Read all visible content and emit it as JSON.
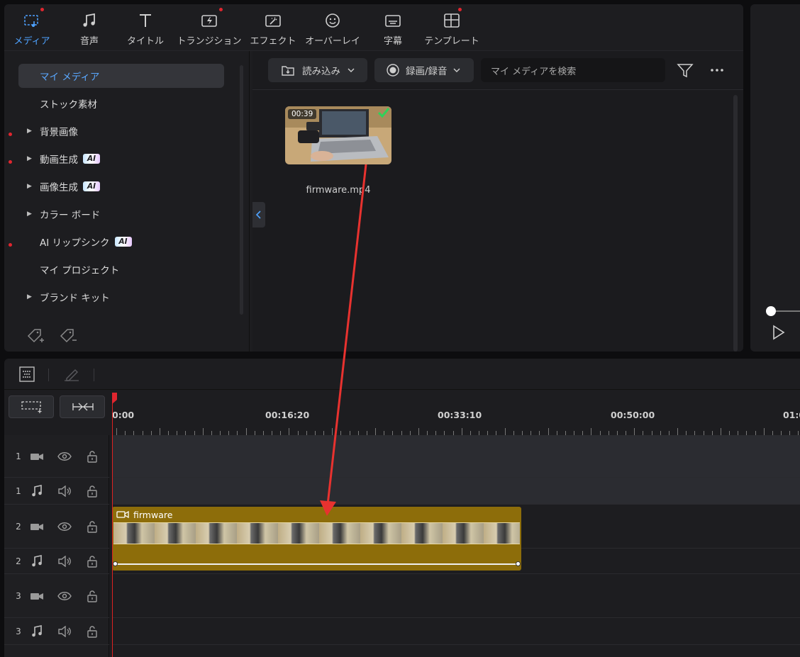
{
  "toolbar": {
    "tabs": [
      {
        "label": "メディア",
        "icon": "media-icon",
        "active": true,
        "badge": true
      },
      {
        "label": "音声",
        "icon": "music-note-icon",
        "badge": false
      },
      {
        "label": "タイトル",
        "icon": "title-T-icon",
        "badge": false
      },
      {
        "label": "トランジション",
        "icon": "transition-icon",
        "badge": true
      },
      {
        "label": "エフェクト",
        "icon": "effect-icon",
        "badge": false
      },
      {
        "label": "オーバーレイ",
        "icon": "overlay-sticker-icon",
        "badge": false
      },
      {
        "label": "字幕",
        "icon": "subtitle-icon",
        "badge": false
      },
      {
        "label": "テンプレート",
        "icon": "template-icon",
        "badge": true
      }
    ]
  },
  "sidebar": {
    "items": [
      {
        "label": "マイ メディア",
        "active": true
      },
      {
        "label": "ストック素材"
      },
      {
        "label": "背景画像",
        "expandable": true,
        "dot": true
      },
      {
        "label": "動画生成",
        "expandable": true,
        "dot": true,
        "ai": "AI"
      },
      {
        "label": "画像生成",
        "expandable": true,
        "ai": "AI"
      },
      {
        "label": "カラー ボード",
        "expandable": true
      },
      {
        "label": "AI リップシンク",
        "dot": true,
        "ai": "AI"
      },
      {
        "label": "マイ プロジェクト"
      },
      {
        "label": "ブランド キット",
        "expandable": true
      }
    ]
  },
  "media": {
    "import_label": "読み込み",
    "record_label": "録画/録音",
    "search_placeholder": "マイ メディアを検索",
    "file": {
      "name": "firmware.mp4",
      "duration": "00:39"
    }
  },
  "timeline": {
    "ruler_labels": [
      "0:00",
      "00:16:20",
      "00:33:10",
      "00:50:00",
      "01:0"
    ],
    "tracks": [
      {
        "num": "1",
        "type": "video"
      },
      {
        "num": "1",
        "type": "audio"
      },
      {
        "num": "2",
        "type": "video"
      },
      {
        "num": "2",
        "type": "audio"
      },
      {
        "num": "3",
        "type": "video"
      },
      {
        "num": "3",
        "type": "audio"
      }
    ],
    "clip": {
      "name": "firmware"
    }
  },
  "colors": {
    "accent": "#4ea2ff",
    "clip": "#8d6d0a",
    "playhead": "#dd2222",
    "arrow": "#e8322f"
  }
}
